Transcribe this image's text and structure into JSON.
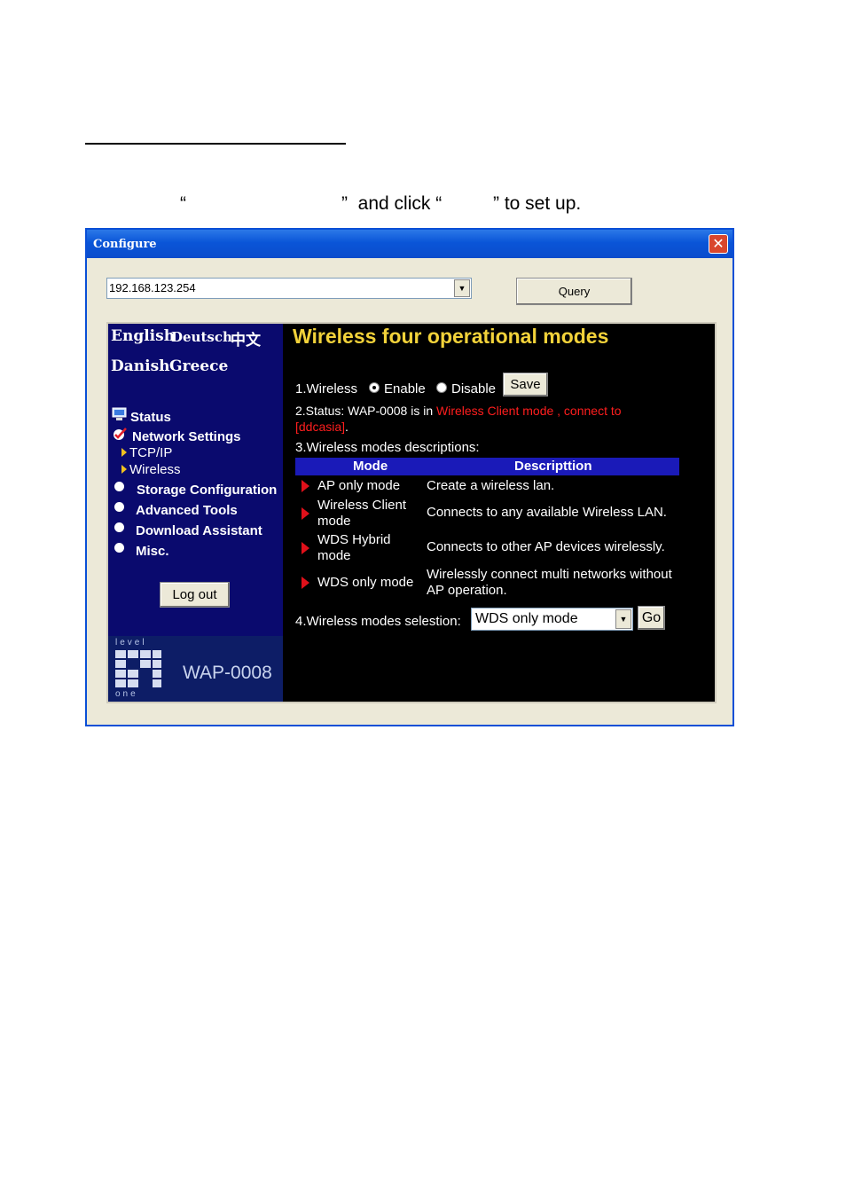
{
  "instruction": {
    "open_quote": "“",
    "close_quote_and_click": "”  and click “",
    "close_quote_to_setup": "” to set up."
  },
  "window": {
    "title": "Configure",
    "close_glyph": "✕"
  },
  "toolbar": {
    "ip_value": "192.168.123.254",
    "query_label": "Query"
  },
  "sidebar": {
    "languages_row1": [
      "English",
      "Deutsch",
      "中文"
    ],
    "languages_row2": [
      "Danish",
      "Greece"
    ],
    "items": [
      {
        "label": "Status",
        "icon": "monitor-icon"
      },
      {
        "label": "Network Settings",
        "icon": "network-check-icon"
      },
      {
        "label": "TCP/IP",
        "icon": "arrow-right-icon"
      },
      {
        "label": "Wireless",
        "icon": "arrow-right-icon"
      },
      {
        "label": "Storage Configuration",
        "icon": "bullet-icon"
      },
      {
        "label": "Advanced Tools",
        "icon": "bullet-icon"
      },
      {
        "label": "Download Assistant",
        "icon": "bullet-icon"
      },
      {
        "label": "Misc.",
        "icon": "bullet-icon"
      }
    ],
    "logout_label": "Log out",
    "logo_top": "level",
    "logo_bottom": "one",
    "model": "WAP-0008"
  },
  "main": {
    "title": "Wireless four operational modes",
    "wireless_label": "1.Wireless",
    "enable_label": "Enable",
    "disable_label": "Disable",
    "wireless_enabled": true,
    "save_label": "Save",
    "status_prefix": "2.Status: WAP-0008 is in ",
    "status_mode": "Wireless Client mode , connect to",
    "status_ssid": "[ddcasia]",
    "status_end": ".",
    "descriptions_label": "3.Wireless modes descriptions:",
    "table_headers": [
      "Mode",
      "Descripttion"
    ],
    "rows": [
      {
        "mode": "AP only mode",
        "desc": "Create a wireless lan."
      },
      {
        "mode": "Wireless Client mode",
        "desc": "Connects to any available Wireless LAN."
      },
      {
        "mode": "WDS Hybrid mode",
        "desc": "Connects to other AP devices wirelessly."
      },
      {
        "mode": "WDS only mode",
        "desc": "Wirelessly connect multi networks without AP operation."
      }
    ],
    "selection_label": "4.Wireless modes selestion:",
    "selection_value": "WDS only mode",
    "go_label": "Go"
  },
  "colors": {
    "titlebar": "#0a55d8",
    "sidebar": "#0a0a6e",
    "title_yellow": "#f2d23a",
    "status_red": "#ff1e1e",
    "table_header": "#1a1ab8"
  }
}
